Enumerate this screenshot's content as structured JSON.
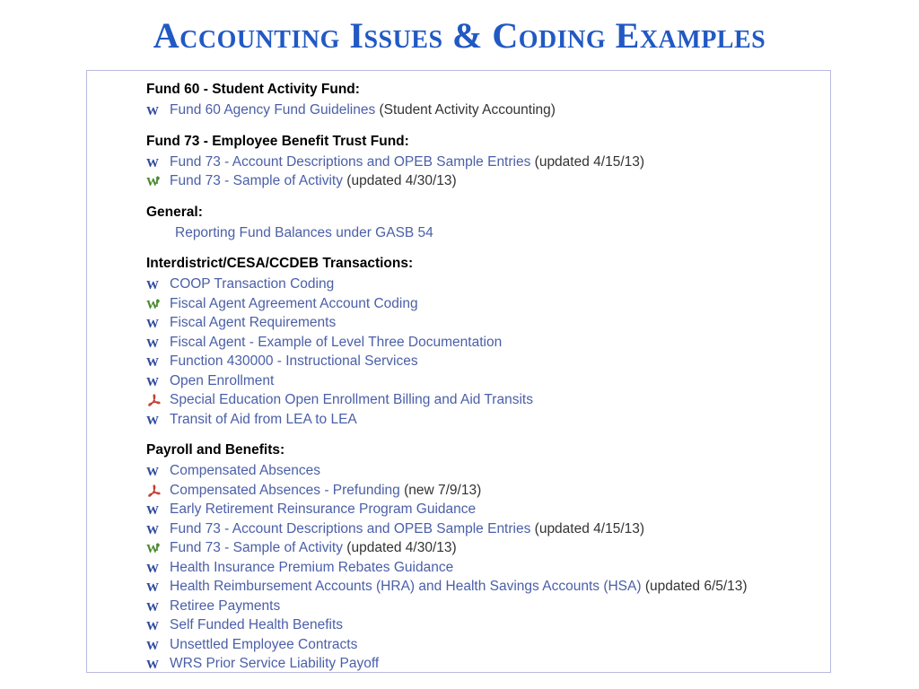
{
  "title": "Accounting Issues & Coding Examples",
  "colors": {
    "title": "#2159c4",
    "link": "#4a5fa8",
    "note": "#333333",
    "border": "#b9b9e0",
    "word_icon": "#2e4a9e",
    "wordperfect_icon": "#4a8a2e",
    "pdf_icon": "#c0392b"
  },
  "sections": [
    {
      "heading": "Fund 60 - Student Activity Fund:",
      "items": [
        {
          "icon": "word-document-icon",
          "text": "Fund 60 Agency Fund Guidelines ",
          "note": "(Student Activity Accounting)"
        }
      ]
    },
    {
      "heading": "Fund 73 - Employee Benefit Trust Fund:",
      "items": [
        {
          "icon": "word-document-icon",
          "text": "Fund 73 - Account Descriptions and OPEB Sample Entries ",
          "note": "(updated 4/15/13)"
        },
        {
          "icon": "wordperfect-document-icon",
          "text": "Fund 73 - Sample of Activity ",
          "note": "(updated 4/30/13)"
        }
      ]
    },
    {
      "heading": "General:",
      "items": [
        {
          "icon": "none",
          "text": "Reporting Fund Balances under GASB 54",
          "note": ""
        }
      ]
    },
    {
      "heading": "Interdistrict/CESA/CCDEB Transactions:",
      "items": [
        {
          "icon": "word-document-icon",
          "text": "COOP Transaction Coding",
          "note": ""
        },
        {
          "icon": "wordperfect-document-icon",
          "text": "Fiscal Agent Agreement Account Coding",
          "note": ""
        },
        {
          "icon": "word-document-icon",
          "text": "Fiscal Agent Requirements",
          "note": ""
        },
        {
          "icon": "word-document-icon",
          "text": "Fiscal Agent - Example of Level Three Documentation",
          "note": ""
        },
        {
          "icon": "word-document-icon",
          "text": "Function 430000 - Instructional Services",
          "note": ""
        },
        {
          "icon": "word-document-icon",
          "text": "Open Enrollment",
          "note": ""
        },
        {
          "icon": "pdf-document-icon",
          "text": "Special Education Open Enrollment Billing and Aid Transits",
          "note": ""
        },
        {
          "icon": "word-document-icon",
          "text": "Transit of Aid from LEA to LEA",
          "note": ""
        }
      ]
    },
    {
      "heading": "Payroll and Benefits:",
      "items": [
        {
          "icon": "word-document-icon",
          "text": "Compensated Absences",
          "note": ""
        },
        {
          "icon": "pdf-document-icon",
          "text": "Compensated Absences - Prefunding ",
          "note": "(new 7/9/13)"
        },
        {
          "icon": "word-document-icon",
          "text": "Early Retirement Reinsurance Program Guidance",
          "note": ""
        },
        {
          "icon": "word-document-icon",
          "text": "Fund 73 - Account Descriptions and OPEB Sample Entries ",
          "note": "(updated 4/15/13)"
        },
        {
          "icon": "wordperfect-document-icon",
          "text": "Fund 73 - Sample of Activity ",
          "note": "(updated 4/30/13)"
        },
        {
          "icon": "word-document-icon",
          "text": "Health Insurance Premium Rebates Guidance",
          "note": ""
        },
        {
          "icon": "word-document-icon",
          "text": "Health Reimbursement Accounts (HRA) and Health Savings Accounts (HSA) ",
          "note": "(updated 6/5/13)"
        },
        {
          "icon": "word-document-icon",
          "text": "Retiree Payments",
          "note": ""
        },
        {
          "icon": "word-document-icon",
          "text": "Self Funded Health Benefits",
          "note": ""
        },
        {
          "icon": "word-document-icon",
          "text": "Unsettled Employee Contracts",
          "note": ""
        },
        {
          "icon": "word-document-icon",
          "text": "WRS Prior Service Liability Payoff",
          "note": ""
        }
      ]
    }
  ]
}
